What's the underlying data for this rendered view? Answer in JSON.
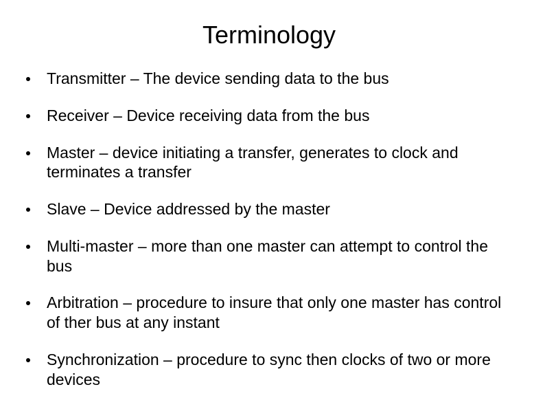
{
  "title": "Terminology",
  "bullets": [
    "Transmitter – The device sending data to the bus",
    "Receiver – Device receiving data from the bus",
    "Master – device initiating a transfer, generates to clock and terminates a transfer",
    "Slave – Device addressed by the master",
    "Multi-master – more than one master can attempt to control the bus",
    "Arbitration – procedure to insure that only one master has control of ther bus at any instant",
    "Synchronization – procedure to sync then clocks of two or more devices"
  ]
}
